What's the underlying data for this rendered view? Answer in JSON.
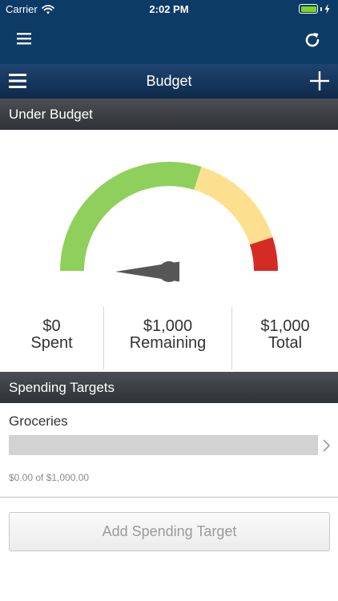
{
  "status_bar": {
    "carrier": "Carrier",
    "time": "2:02 PM"
  },
  "nav": {
    "title": "Budget"
  },
  "budget_header": {
    "label": "Under Budget"
  },
  "gauge": {
    "spent_fraction": 0.0,
    "zones": [
      "#8ed05b",
      "#fde08f",
      "#d52b25"
    ]
  },
  "summary": {
    "spent": {
      "value": "$0",
      "label": "Spent"
    },
    "remaining": {
      "value": "$1,000",
      "label": "Remaining"
    },
    "total": {
      "value": "$1,000",
      "label": "Total"
    }
  },
  "targets_header": {
    "label": "Spending Targets"
  },
  "targets": [
    {
      "name": "Groceries",
      "amount_text": "$0.00 of $1,000.00",
      "progress": 0.0
    }
  ],
  "add_button": {
    "label": "Add Spending Target"
  }
}
